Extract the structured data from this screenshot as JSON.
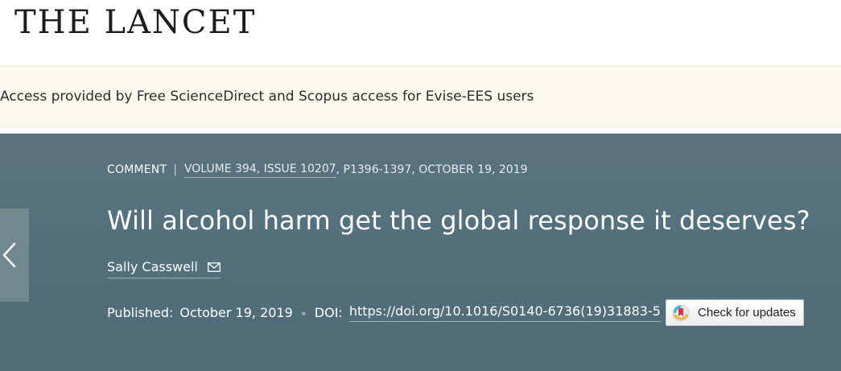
{
  "header": {
    "logo_text": "THE LANCET"
  },
  "access_bar": {
    "text": "Access provided by Free ScienceDirect and Scopus access for Evise-EES users"
  },
  "article": {
    "type": "COMMENT",
    "separator": "|",
    "volume_issue": "VOLUME 394, ISSUE 10207",
    "pages_date": ", P1396-1397, OCTOBER 19, 2019",
    "title": "Will alcohol harm get the global response it deserves?",
    "author": "Sally Casswell",
    "published_label": "Published:",
    "published_date": "October 19, 2019",
    "doi_label": "DOI:",
    "doi_url": "https://doi.org/10.1016/S0140-6736(19)31883-5",
    "check_updates_label": "Check for updates"
  },
  "icons": {
    "back": "chevron-left-icon",
    "author_contact": "mail-icon",
    "check_updates": "crossmark-icon"
  },
  "colors": {
    "banner": "#52707c",
    "access_bar": "#fdfbf1",
    "title_text": "#ffffff"
  }
}
